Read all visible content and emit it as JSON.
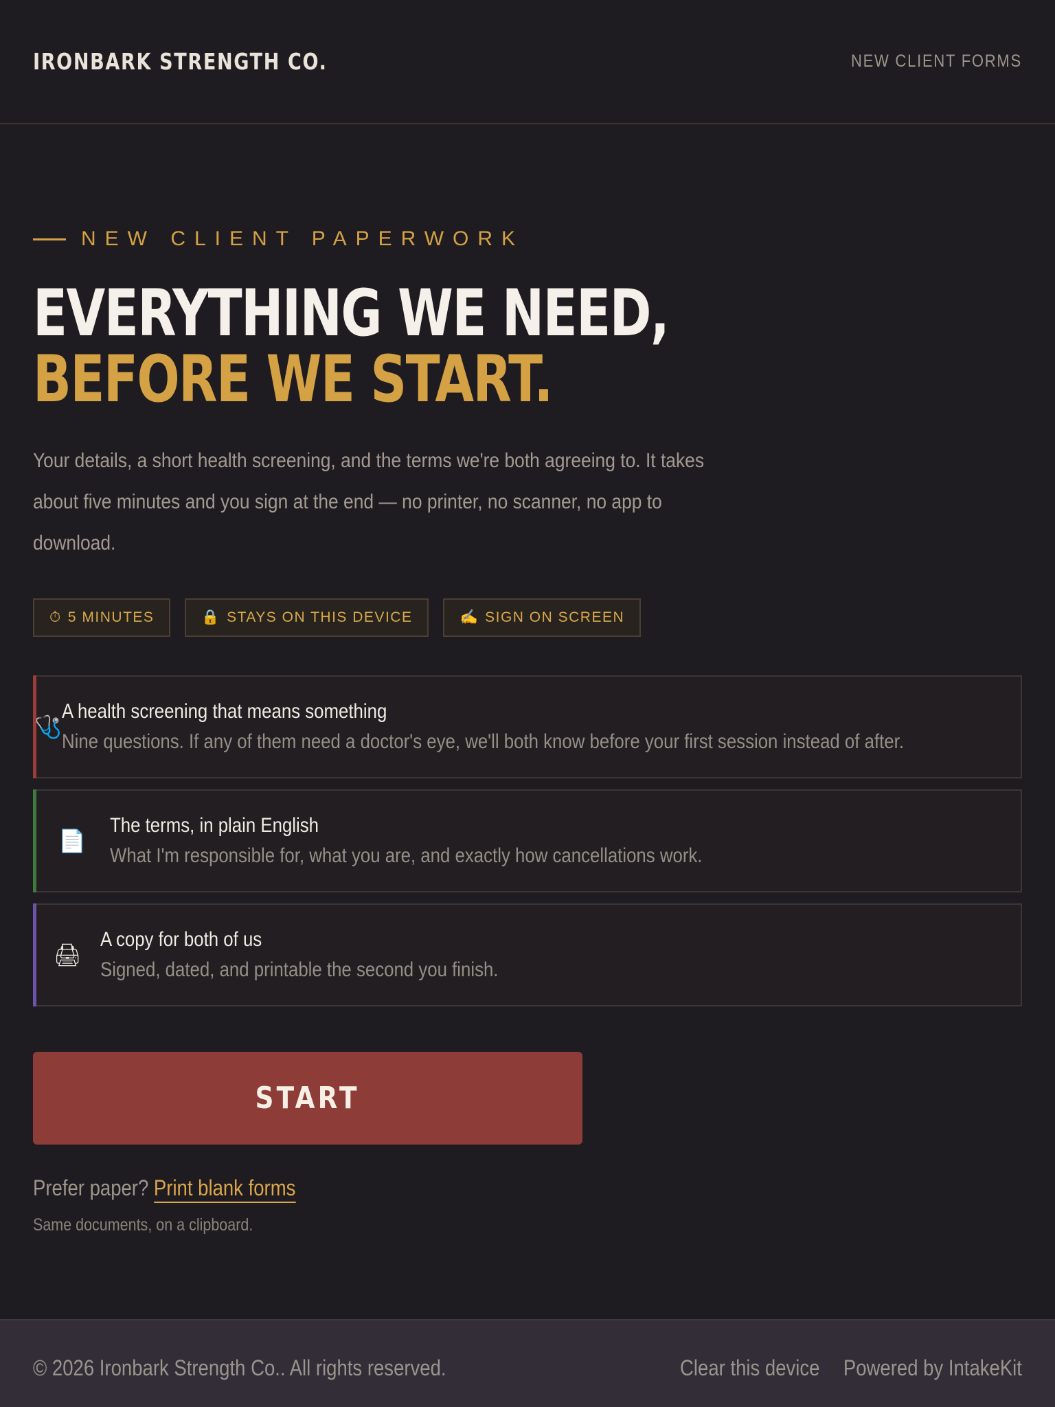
{
  "header": {
    "brand": "IRONBARK STRENGTH CO.",
    "nav_link": "NEW CLIENT FORMS"
  },
  "hero": {
    "eyebrow": "NEW CLIENT PAPERWORK",
    "headline_line1": "EVERYTHING WE NEED,",
    "headline_line2": "BEFORE WE START.",
    "intro": "Your details, a short health screening, and the terms we're both agreeing to. It takes about five minutes and you sign at the end — no printer, no scanner, no app to download."
  },
  "badges": [
    {
      "icon": "stopwatch-icon",
      "glyph": "⏱",
      "label": "5 MINUTES"
    },
    {
      "icon": "lock-icon",
      "glyph": "🔒",
      "label": "STAYS ON THIS DEVICE"
    },
    {
      "icon": "writing-hand-icon",
      "glyph": "✍",
      "label": "SIGN ON SCREEN"
    }
  ],
  "cards": [
    {
      "icon": "stethoscope-icon",
      "glyph": "🩺",
      "accent": "#9a3d38",
      "title": "A health screening that means something",
      "desc": "Nine questions. If any of them need a doctor's eye, we'll both know before your first session instead of after."
    },
    {
      "icon": "document-icon",
      "glyph": "📄",
      "accent": "#3e7a3d",
      "title": "The terms, in plain English",
      "desc": "What I'm responsible for, what you are, and exactly how cancellations work."
    },
    {
      "icon": "printer-icon",
      "glyph": "🖨",
      "accent": "#6d54a8",
      "title": "A copy for both of us",
      "desc": "Signed, dated, and printable the second you finish."
    }
  ],
  "actions": {
    "start_label": "START",
    "paper_prefix": "Prefer paper?",
    "paper_link": "Print blank forms",
    "paper_sub": "Same documents, on a clipboard."
  },
  "footer": {
    "copyright": "© 2026 Ironbark Strength Co.. All rights reserved.",
    "clear_device": "Clear this device",
    "powered_by": "Powered by IntakeKit"
  },
  "colors": {
    "background": "#1f1c21",
    "gold_accent": "#d4a244",
    "start_button": "#8e3c37",
    "footer_bg": "#322d37"
  }
}
